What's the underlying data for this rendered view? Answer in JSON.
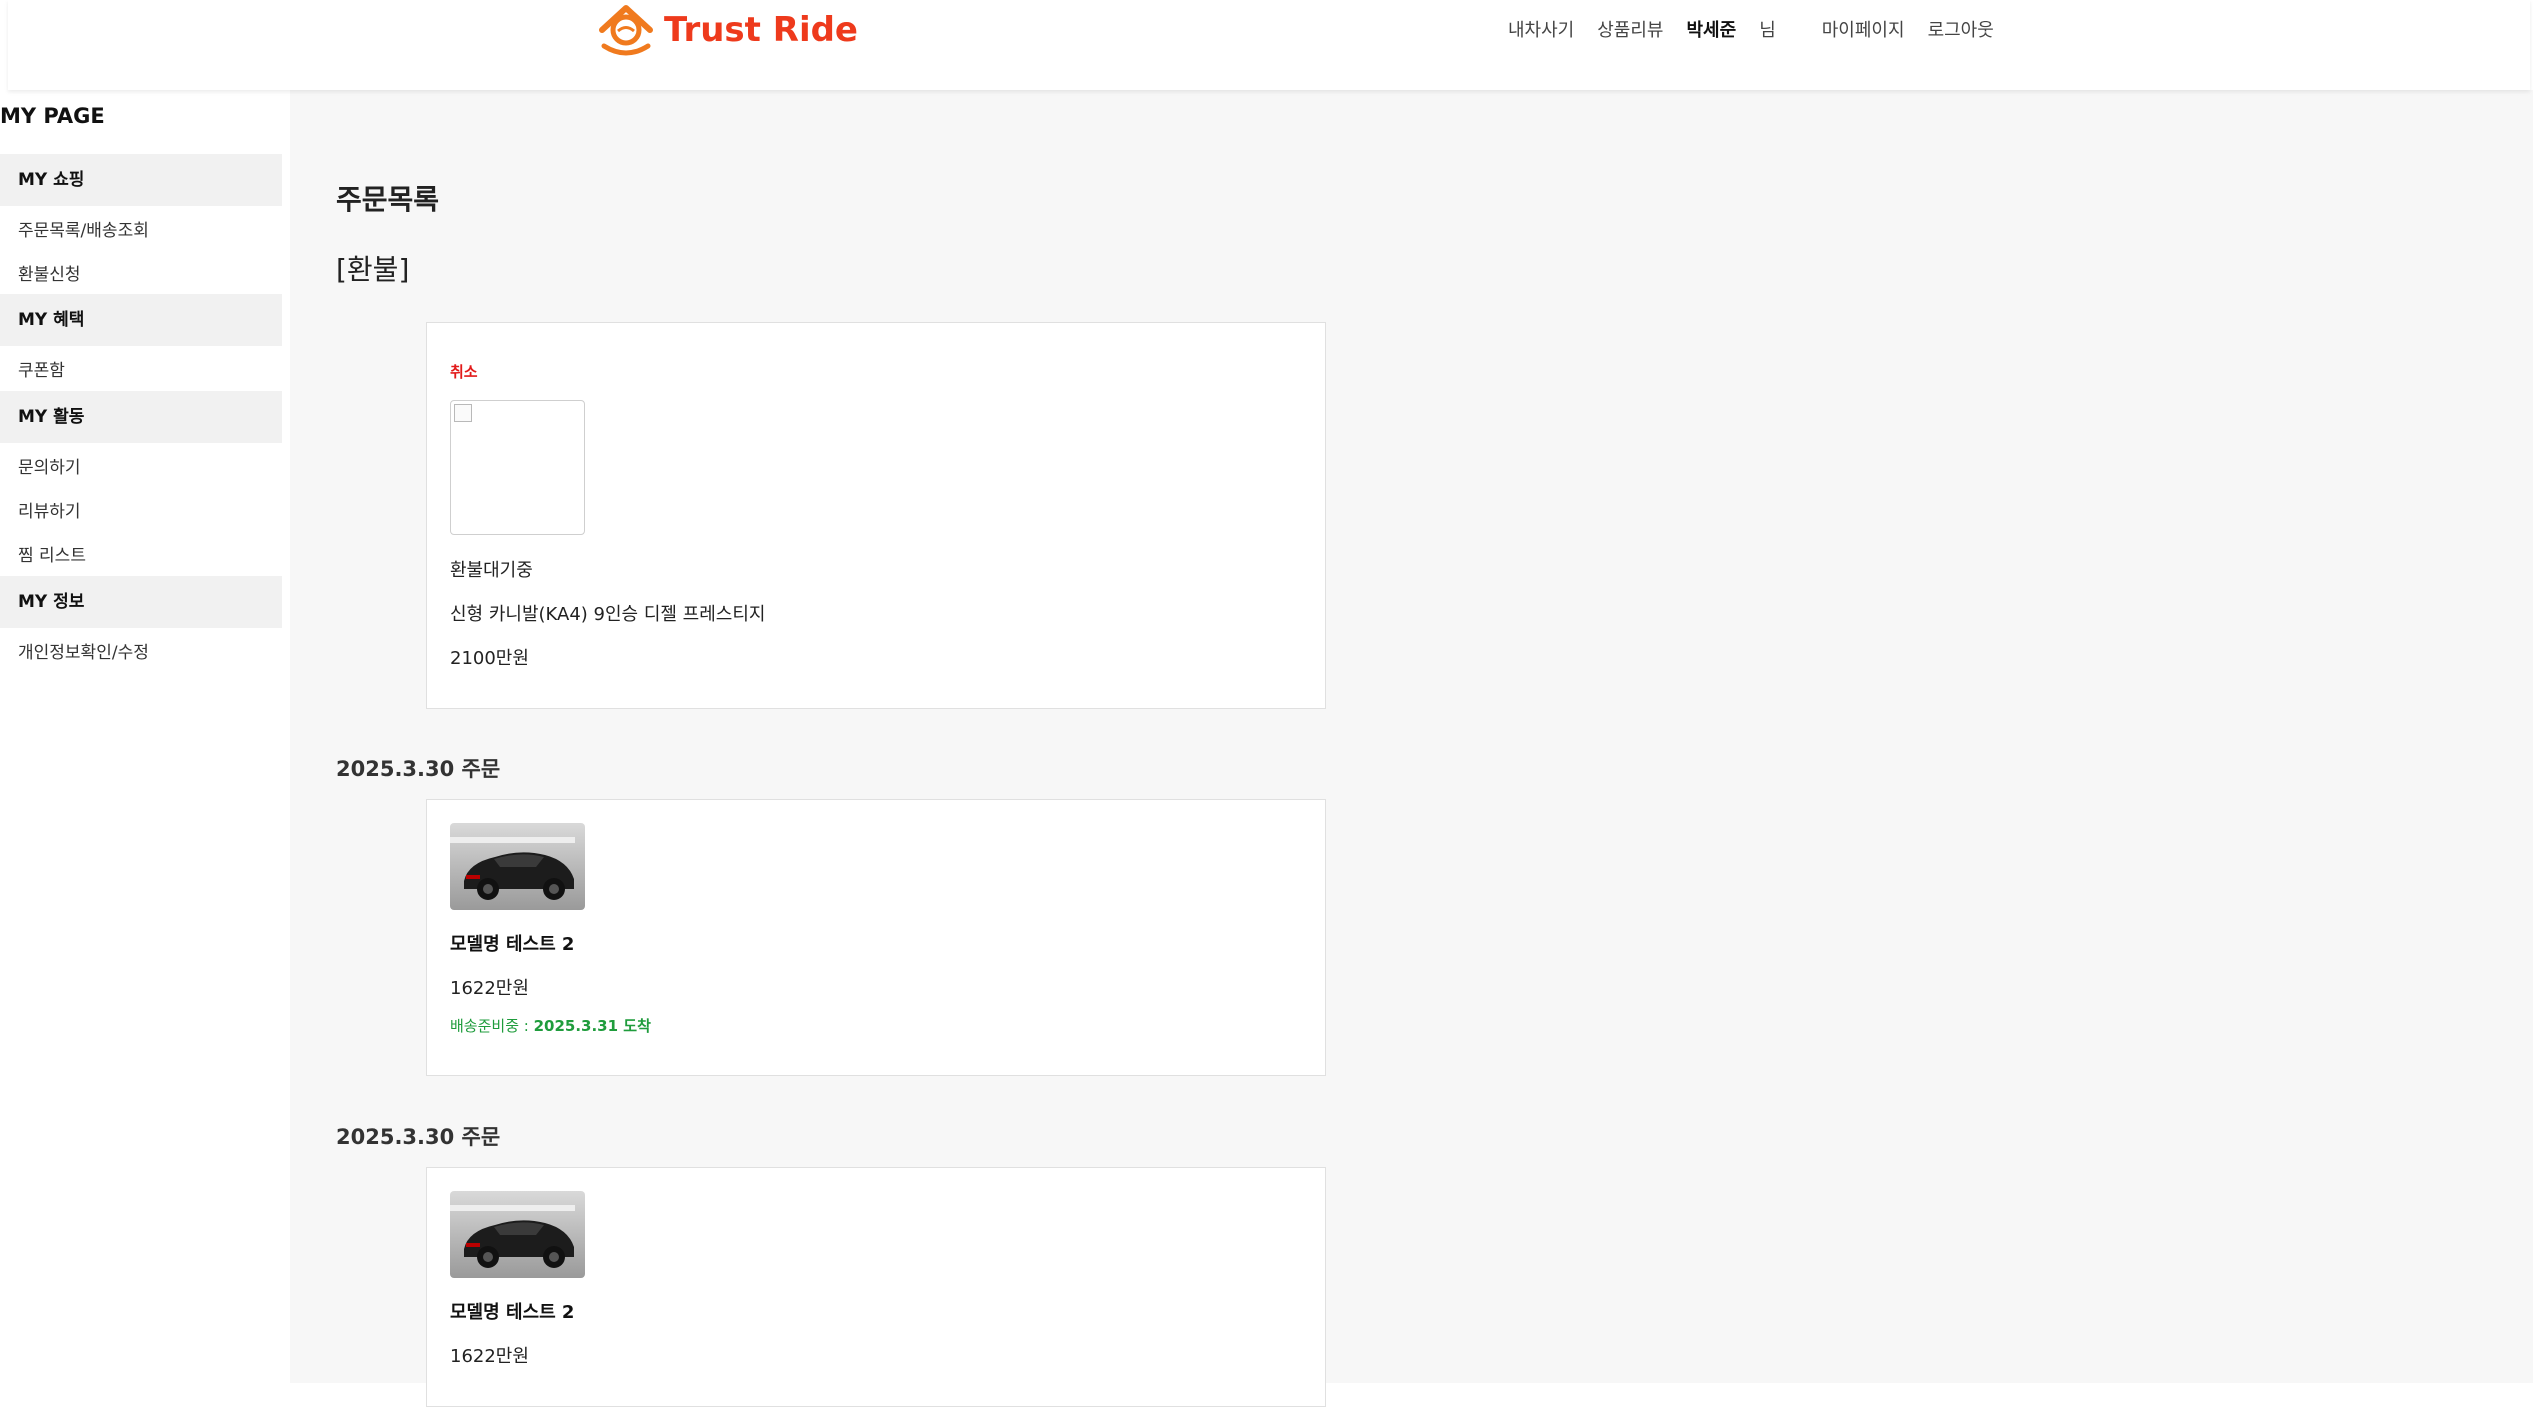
{
  "brand": {
    "name": "Trust Ride",
    "accent": "#ee3a1c"
  },
  "nav": {
    "items": [
      "내차사기",
      "상품리뷰"
    ],
    "user_name": "박세준",
    "user_suffix": "님",
    "mypage": "마이페이지",
    "logout": "로그아웃"
  },
  "sidebar": {
    "title": "MY PAGE",
    "groups": [
      {
        "label": "MY 쇼핑",
        "links": [
          "주문목록/배송조회",
          "환불신청"
        ]
      },
      {
        "label": "MY 혜택",
        "links": [
          "쿠폰함"
        ]
      },
      {
        "label": "MY 활동",
        "links": [
          "문의하기",
          "리뷰하기",
          "찜 리스트"
        ]
      },
      {
        "label": "MY 정보",
        "links": [
          "개인정보확인/수정"
        ]
      }
    ]
  },
  "main": {
    "title": "주문목록",
    "refund_section": "[환불]",
    "refund_card": {
      "status_label": "취소",
      "state": "환불대기중",
      "product": "신형 카니발(KA4) 9인승 디젤 프레스티지",
      "price": "2100만원"
    },
    "orders": [
      {
        "date_label": "2025.3.30 주문",
        "model": "모델명 테스트 2",
        "price": "1622만원",
        "ship_prefix": "배송준비중 : ",
        "ship_date": "2025.3.31 도착"
      },
      {
        "date_label": "2025.3.30 주문",
        "model": "모델명 테스트 2",
        "price": "1622만원"
      }
    ],
    "status_colors": {
      "cancel": "#e21a1a",
      "shipping": "#1f9c3c"
    }
  }
}
